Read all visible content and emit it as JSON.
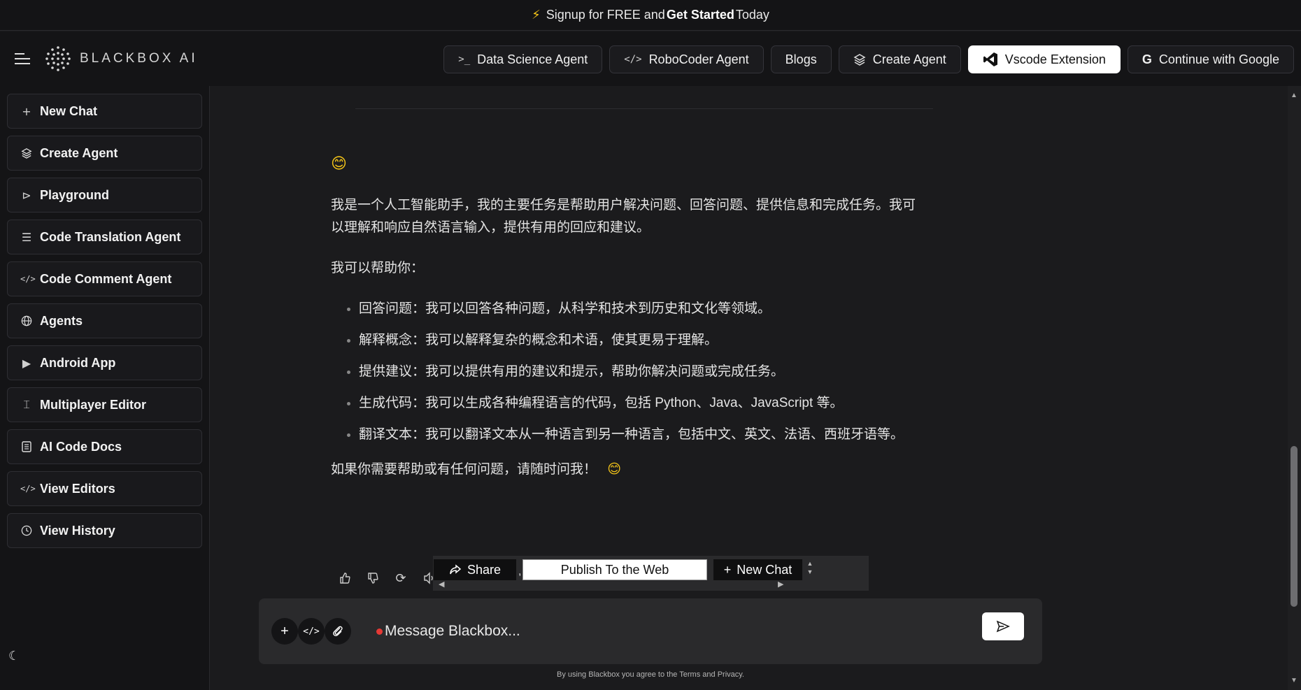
{
  "banner": {
    "pre": "Signup for FREE and",
    "bold": "Get Started",
    "post": "Today"
  },
  "header": {
    "logo_text": "BLACKBOX AI",
    "nav": [
      {
        "label": "Data Science Agent",
        "icon": "terminal-icon"
      },
      {
        "label": "RoboCoder Agent",
        "icon": "code-icon"
      },
      {
        "label": "Blogs"
      },
      {
        "label": "Create Agent",
        "icon": "layers-icon"
      },
      {
        "label": "Vscode Extension",
        "icon": "vscode-icon"
      },
      {
        "label": "Continue with Google",
        "icon": "google-icon"
      }
    ]
  },
  "sidebar": {
    "items": [
      {
        "label": "New Chat",
        "icon": "plus-icon"
      },
      {
        "label": "Create Agent",
        "icon": "layers-icon"
      },
      {
        "label": "Playground",
        "icon": "play-icon"
      },
      {
        "label": "Code Translation Agent",
        "icon": "list-icon"
      },
      {
        "label": "Code Comment Agent",
        "icon": "code-icon"
      },
      {
        "label": "Agents",
        "icon": "globe-icon"
      },
      {
        "label": "Android App",
        "icon": "google-play-icon"
      },
      {
        "label": "Multiplayer Editor",
        "icon": "text-cursor-icon"
      },
      {
        "label": "AI Code Docs",
        "icon": "document-icon"
      },
      {
        "label": "View Editors",
        "icon": "code-icon"
      },
      {
        "label": "View History",
        "icon": "clock-icon"
      }
    ]
  },
  "chat": {
    "emoji": "😊",
    "intro": "我是一个人工智能助手，我的主要任务是帮助用户解决问题、回答问题、提供信息和完成任务。我可以理解和响应自然语言输入，提供有用的回应和建议。",
    "can_help": "我可以帮助你：",
    "items": [
      "回答问题：我可以回答各种问题，从科学和技术到历史和文化等领域。",
      "解释概念：我可以解释复杂的概念和术语，使其更易于理解。",
      "提供建议：我可以提供有用的建议和提示，帮助你解决问题或完成任务。",
      "生成代码：我可以生成各种编程语言的代码，包括 Python、Java、JavaScript 等。",
      "翻译文本：我可以翻译文本从一种语言到另一种语言，包括中文、英文、法语、西班牙语等。"
    ],
    "closing": "如果你需要帮助或有任何问题，请随时问我！",
    "closing_emoji": "😊"
  },
  "actions": {
    "share_label": "Share",
    "publish_label": "Publish To the Web",
    "new_chat_label": "New Chat"
  },
  "input": {
    "placeholder": "Message Blackbox..."
  },
  "terms": "By using Blackbox you agree to the Terms and Privacy."
}
